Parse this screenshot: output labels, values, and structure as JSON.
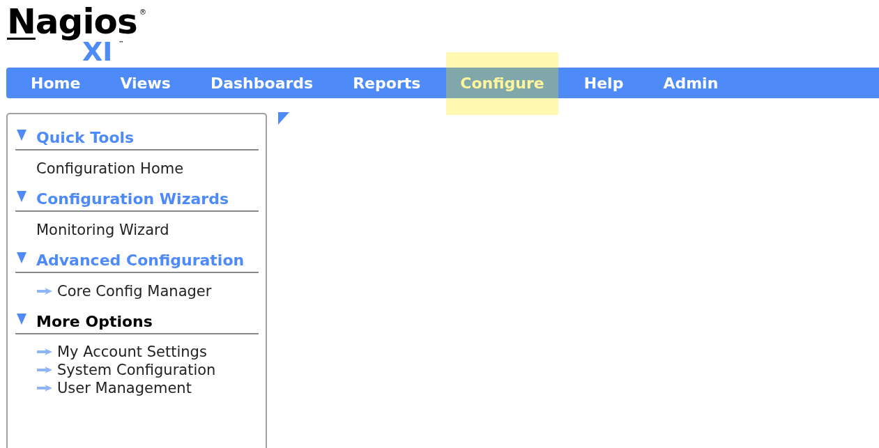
{
  "logo": {
    "name": "Nagios",
    "registered": "®",
    "product": "XI",
    "trademark": "™"
  },
  "nav": [
    {
      "label": "Home",
      "selected": false
    },
    {
      "label": "Views",
      "selected": false
    },
    {
      "label": "Dashboards",
      "selected": false
    },
    {
      "label": "Reports",
      "selected": false
    },
    {
      "label": "Configure",
      "selected": true
    },
    {
      "label": "Help",
      "selected": false
    },
    {
      "label": "Admin",
      "selected": false
    }
  ],
  "sidebar": {
    "sections": [
      {
        "title": "Quick Tools",
        "kind": "link",
        "expanded": true,
        "items": [
          {
            "label": "Configuration Home",
            "kind": "plain"
          }
        ]
      },
      {
        "title": "Configuration Wizards",
        "kind": "link",
        "expanded": true,
        "items": [
          {
            "label": "Monitoring Wizard",
            "kind": "plain"
          }
        ]
      },
      {
        "title": "Advanced Configuration",
        "kind": "link",
        "expanded": true,
        "items": [
          {
            "label": "Core Config Manager",
            "kind": "arrow"
          }
        ]
      },
      {
        "title": "More Options",
        "kind": "label",
        "expanded": true,
        "items": [
          {
            "label": "My Account Settings",
            "kind": "arrow"
          },
          {
            "label": "System Configuration",
            "kind": "arrow"
          },
          {
            "label": "User Management",
            "kind": "arrow"
          }
        ]
      }
    ]
  }
}
